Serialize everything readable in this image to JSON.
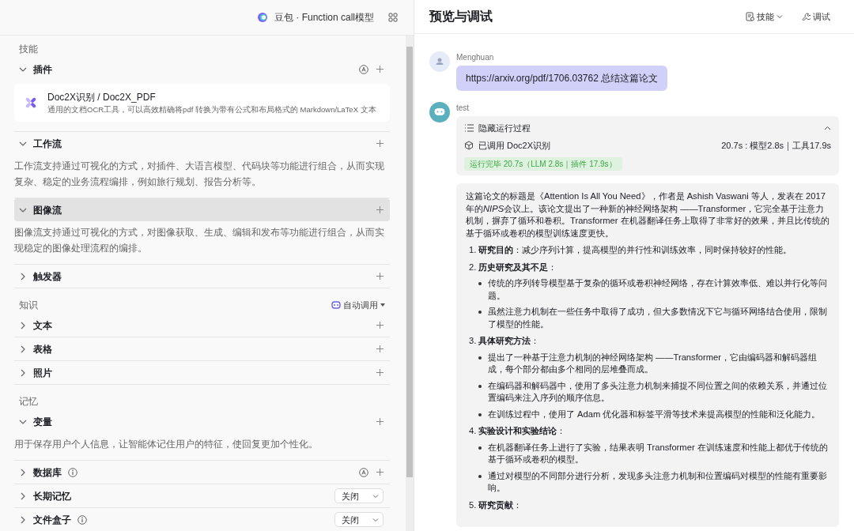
{
  "left_panel": {
    "model": "豆包 · Function call模型",
    "groups": [
      {
        "label": "技能",
        "items": [
          {
            "title": "插件",
            "expanded": true,
            "highlighted": false,
            "auto": true,
            "add": true,
            "plugins": [
              {
                "name": "Doc2X识别 / Doc2X_PDF",
                "desc": "通用的文档OCR工具，可以高效精确将pdf 转换为带有公式和布局格式的 Markdown/LaTeX 文本"
              }
            ]
          },
          {
            "title": "工作流",
            "expanded": true,
            "highlighted": false,
            "add": true,
            "desc": "工作流支持通过可视化的方式，对插件、大语言模型、代码块等功能进行组合，从而实现复杂、稳定的业务流程编排，例如旅行规划、报告分析等。"
          },
          {
            "title": "图像流",
            "expanded": true,
            "highlighted": true,
            "add": true,
            "desc": "图像流支持通过可视化的方式，对图像获取、生成、编辑和发布等功能进行组合，从而实现稳定的图像处理流程的编排。"
          },
          {
            "title": "触发器",
            "expanded": false,
            "highlighted": false,
            "add": true
          }
        ]
      },
      {
        "label": "知识",
        "mode": "自动调用",
        "items": [
          {
            "title": "文本",
            "expanded": false,
            "highlighted": false,
            "add": true
          },
          {
            "title": "表格",
            "expanded": false,
            "highlighted": false,
            "add": true
          },
          {
            "title": "照片",
            "expanded": false,
            "highlighted": false,
            "add": true
          }
        ]
      },
      {
        "label": "记忆",
        "items": [
          {
            "title": "变量",
            "expanded": true,
            "highlighted": false,
            "add": true,
            "desc": "用于保存用户个人信息，让智能体记住用户的特征，使回复更加个性化。"
          },
          {
            "title": "数据库",
            "expanded": false,
            "highlighted": false,
            "info": true,
            "auto": true,
            "add": true
          },
          {
            "title": "长期记忆",
            "expanded": false,
            "highlighted": false,
            "select": "关闭"
          },
          {
            "title": "文件盒子",
            "expanded": false,
            "highlighted": false,
            "info": true,
            "select": "关闭"
          }
        ]
      }
    ]
  },
  "preview": {
    "title": "预览与调试",
    "buttons": [
      {
        "kind": "dropdown",
        "label": "技能"
      },
      {
        "kind": "plain",
        "label": "调试"
      }
    ],
    "messages": [
      {
        "kind": "user",
        "name": "Menghuan",
        "text": "https://arxiv.org/pdf/1706.03762 总结这篇论文"
      },
      {
        "kind": "bot",
        "name": "test",
        "process": {
          "toggle": "隐藏运行过程",
          "expanded": true,
          "call": "已调用 Doc2X识别",
          "timing": "20.7s : 模型2.8s｜工具17.9s",
          "status": "运行完毕 20.7s（LLM 2.8s｜插件 17.9s）"
        },
        "answer": {
          "intro": [
            {
              "text": "这篇论文的标题是《Attention Is All You Need》，作者是 Ashish Vaswani 等人，发表在 2017 年的",
              "italic": false
            },
            {
              "text": "NIPS",
              "italic": true
            },
            {
              "text": "会议上。该论文提出了一种新的神经网络架构 ——Transformer，它完全基于注意力机制，摒弃了循环和卷积。Transformer 在机器翻译任务上取得了非常好的效果，并且比传统的基于循环或卷积的模型训练速度更快。",
              "italic": false
            }
          ],
          "points": [
            {
              "num": "1.",
              "text": "**研究目的**：减少序列计算，提高模型的并行性和训练效率，同时保持较好的性能。"
            },
            {
              "num": "2.",
              "text": "**历史研究及其不足**：",
              "bullets": [
                "传统的序列转导模型基于复杂的循环或卷积神经网络，存在计算效率低、难以并行化等问题。",
                "虽然注意力机制在一些任务中取得了成功，但大多数情况下它与循环网络结合使用，限制了模型的性能。"
              ]
            },
            {
              "num": "3.",
              "text": "**具体研究方法**：",
              "bullets": [
                "提出了一种基于注意力机制的神经网络架构 ——Transformer，它由编码器和解码器组成，每个部分都由多个相同的层堆叠而成。",
                "在编码器和解码器中，使用了多头注意力机制来捕捉不同位置之间的依赖关系，并通过位置编码来注入序列的顺序信息。",
                "在训练过程中，使用了 Adam 优化器和标签平滑等技术来提高模型的性能和泛化能力。"
              ]
            },
            {
              "num": "4.",
              "text": "**实验设计和实验结论**：",
              "bullets": [
                "在机器翻译任务上进行了实验，结果表明 Transformer 在训练速度和性能上都优于传统的基于循环或卷积的模型。",
                "通过对模型的不同部分进行分析，发现多头注意力机制和位置编码对模型的性能有重要影响。"
              ]
            },
            {
              "num": "5.",
              "text": "**研究贡献**："
            }
          ]
        }
      }
    ]
  }
}
